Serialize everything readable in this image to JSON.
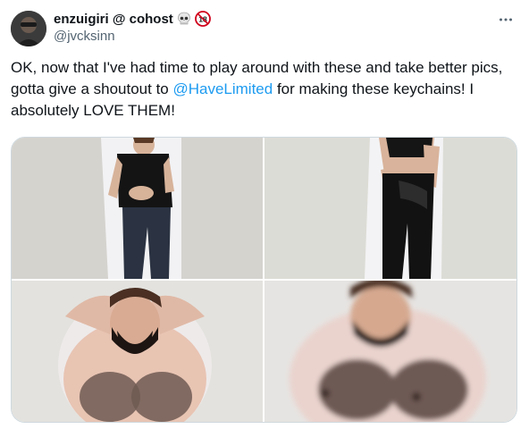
{
  "author": {
    "display_name": "enzuigiri @ cohost",
    "handle": "@jvcksinn",
    "badges": [
      "skull-emoji",
      "18-plus-badge"
    ]
  },
  "tweet": {
    "text_before": "OK, now that I've had time to play around with these and take better pics, gotta give a shoutout to ",
    "mention": "@HaveLimited",
    "text_after": " for making these keychains! I absolutely LOVE THEM!"
  },
  "media": {
    "count": 4,
    "images": [
      {
        "name": "keychain-front-full"
      },
      {
        "name": "keychain-back-full"
      },
      {
        "name": "keychain-front-closeup"
      },
      {
        "name": "keychain-front-closeup-blurred"
      }
    ]
  },
  "colors": {
    "mention": "#1d9bf0",
    "secondary_text": "#536471",
    "primary_text": "#0f1419"
  },
  "icons": [
    "more-options-icon"
  ]
}
